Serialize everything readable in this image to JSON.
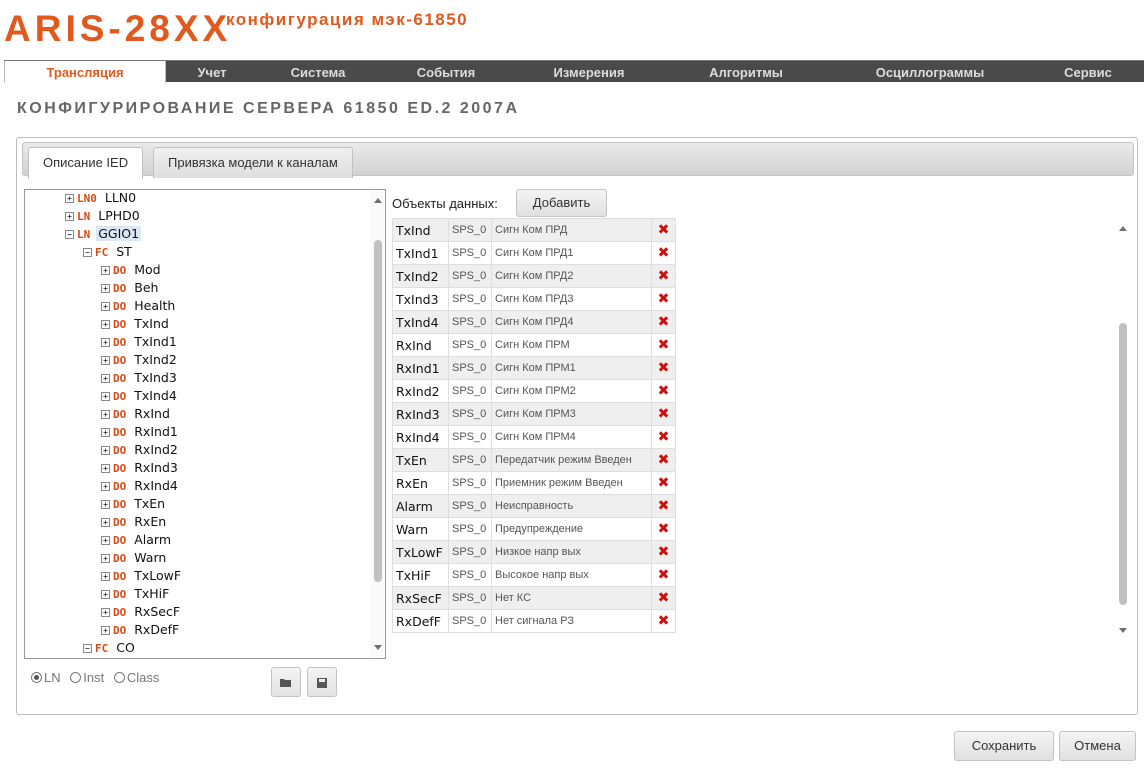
{
  "brand": {
    "name": "ARIS-28XX",
    "subtitle": "конфигурация мэк-61850"
  },
  "menu": {
    "items": [
      {
        "label": "Трансляция",
        "active": true
      },
      {
        "label": "Учет"
      },
      {
        "label": "Система"
      },
      {
        "label": "События"
      },
      {
        "label": "Измерения"
      },
      {
        "label": "Алгоритмы"
      },
      {
        "label": "Осциллограммы"
      },
      {
        "label": "Сервис"
      }
    ]
  },
  "page_title": "КОНФИГУРИРОВАНИЕ СЕРВЕРА 61850 ED.2 2007A",
  "tabs": [
    {
      "label": "Описание IED",
      "active": true
    },
    {
      "label": "Привязка модели к каналам"
    }
  ],
  "tree": {
    "rows": [
      {
        "toggle": "+",
        "tag": "LN0",
        "name": "LLN0"
      },
      {
        "toggle": "+",
        "tag": "LN",
        "name": "LPHD0"
      },
      {
        "toggle": "−",
        "tag": "LN",
        "name": "GGIO1",
        "selected": true
      },
      {
        "toggle": "−",
        "tag": "FC",
        "name": "ST"
      },
      {
        "toggle": "+",
        "tag": "DO",
        "name": "Mod"
      },
      {
        "toggle": "+",
        "tag": "DO",
        "name": "Beh"
      },
      {
        "toggle": "+",
        "tag": "DO",
        "name": "Health"
      },
      {
        "toggle": "+",
        "tag": "DO",
        "name": "TxInd"
      },
      {
        "toggle": "+",
        "tag": "DO",
        "name": "TxInd1"
      },
      {
        "toggle": "+",
        "tag": "DO",
        "name": "TxInd2"
      },
      {
        "toggle": "+",
        "tag": "DO",
        "name": "TxInd3"
      },
      {
        "toggle": "+",
        "tag": "DO",
        "name": "TxInd4"
      },
      {
        "toggle": "+",
        "tag": "DO",
        "name": "RxInd"
      },
      {
        "toggle": "+",
        "tag": "DO",
        "name": "RxInd1"
      },
      {
        "toggle": "+",
        "tag": "DO",
        "name": "RxInd2"
      },
      {
        "toggle": "+",
        "tag": "DO",
        "name": "RxInd3"
      },
      {
        "toggle": "+",
        "tag": "DO",
        "name": "RxInd4"
      },
      {
        "toggle": "+",
        "tag": "DO",
        "name": "TxEn"
      },
      {
        "toggle": "+",
        "tag": "DO",
        "name": "RxEn"
      },
      {
        "toggle": "+",
        "tag": "DO",
        "name": "Alarm"
      },
      {
        "toggle": "+",
        "tag": "DO",
        "name": "Warn"
      },
      {
        "toggle": "+",
        "tag": "DO",
        "name": "TxLowF"
      },
      {
        "toggle": "+",
        "tag": "DO",
        "name": "TxHiF"
      },
      {
        "toggle": "+",
        "tag": "DO",
        "name": "RxSecF"
      },
      {
        "toggle": "+",
        "tag": "DO",
        "name": "RxDefF"
      },
      {
        "toggle": "−",
        "tag": "FC",
        "name": "CO"
      }
    ]
  },
  "search_mode": {
    "options": [
      "LN",
      "Inst",
      "Class"
    ],
    "selected": "LN"
  },
  "data_objects": {
    "label": "Объекты данных:",
    "add_label": "Добавить",
    "rows": [
      {
        "name": "TxInd",
        "type": "SPS_0",
        "desc": "Сигн Ком ПРД"
      },
      {
        "name": "TxInd1",
        "type": "SPS_0",
        "desc": "Сигн Ком ПРД1"
      },
      {
        "name": "TxInd2",
        "type": "SPS_0",
        "desc": "Сигн Ком ПРД2"
      },
      {
        "name": "TxInd3",
        "type": "SPS_0",
        "desc": "Сигн Ком ПРД3"
      },
      {
        "name": "TxInd4",
        "type": "SPS_0",
        "desc": "Сигн Ком ПРД4"
      },
      {
        "name": "RxInd",
        "type": "SPS_0",
        "desc": "Сигн Ком ПРМ"
      },
      {
        "name": "RxInd1",
        "type": "SPS_0",
        "desc": "Сигн Ком ПРМ1"
      },
      {
        "name": "RxInd2",
        "type": "SPS_0",
        "desc": "Сигн Ком ПРМ2"
      },
      {
        "name": "RxInd3",
        "type": "SPS_0",
        "desc": "Сигн Ком ПРМ3"
      },
      {
        "name": "RxInd4",
        "type": "SPS_0",
        "desc": "Сигн Ком ПРМ4"
      },
      {
        "name": "TxEn",
        "type": "SPS_0",
        "desc": "Передатчик режим Введен"
      },
      {
        "name": "RxEn",
        "type": "SPS_0",
        "desc": "Приемник режим Введен"
      },
      {
        "name": "Alarm",
        "type": "SPS_0",
        "desc": "Неисправность"
      },
      {
        "name": "Warn",
        "type": "SPS_0",
        "desc": "Предупреждение"
      },
      {
        "name": "TxLowF",
        "type": "SPS_0",
        "desc": "Низкое напр вых"
      },
      {
        "name": "TxHiF",
        "type": "SPS_0",
        "desc": "Высокое напр вых"
      },
      {
        "name": "RxSecF",
        "type": "SPS_0",
        "desc": "Нет КС"
      },
      {
        "name": "RxDefF",
        "type": "SPS_0",
        "desc": "Нет сигнала РЗ"
      }
    ]
  },
  "footer": {
    "save_label": "Сохранить",
    "cancel_label": "Отмена"
  },
  "colors": {
    "brand": "#e0591e",
    "menu_bg": "#4a4a4a",
    "delete": "#d01010"
  }
}
